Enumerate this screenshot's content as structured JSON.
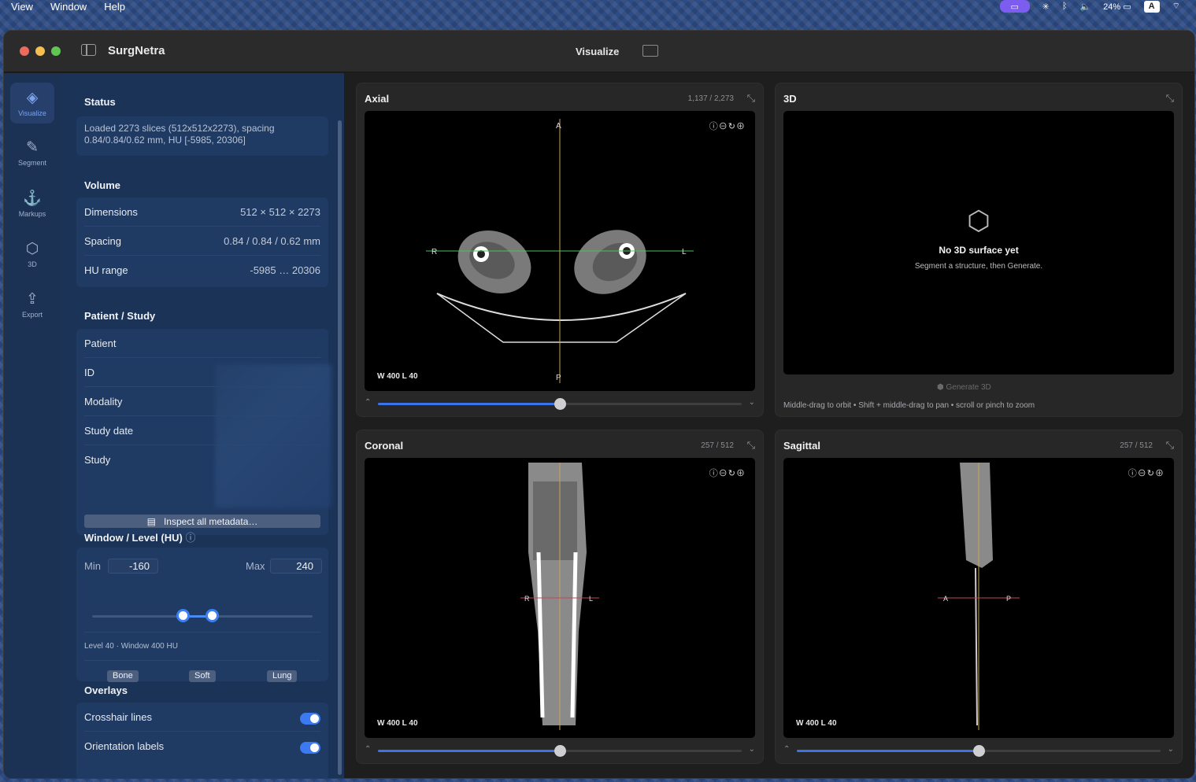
{
  "menubar": {
    "items": [
      "View",
      "Window",
      "Help"
    ],
    "battery": "24%",
    "keyboard": "A"
  },
  "window": {
    "app_title": "SurgNetra",
    "title": "Visualize"
  },
  "rail": [
    {
      "label": "Visualize",
      "icon": "layers-icon"
    },
    {
      "label": "Segment",
      "icon": "brush-icon"
    },
    {
      "label": "Markups",
      "icon": "pin-icon"
    },
    {
      "label": "3D",
      "icon": "cube-icon"
    },
    {
      "label": "Export",
      "icon": "share-icon"
    }
  ],
  "status": {
    "heading": "Status",
    "text": "Loaded 2273 slices (512x512x2273), spacing 0.84/0.84/0.62 mm, HU [-5985, 20306]"
  },
  "volume": {
    "heading": "Volume",
    "rows": [
      {
        "k": "Dimensions",
        "v": "512 × 512 × 2273"
      },
      {
        "k": "Spacing",
        "v": "0.84 / 0.84 / 0.62 mm"
      },
      {
        "k": "HU range",
        "v": "-5985 … 20306"
      }
    ]
  },
  "patient": {
    "heading": "Patient / Study",
    "rows": [
      "Patient",
      "ID",
      "Modality",
      "Study date",
      "Study"
    ],
    "inspect_label": "Inspect all metadata…"
  },
  "window_level": {
    "heading": "Window / Level (HU)",
    "min_label": "Min",
    "min_value": "-160",
    "max_label": "Max",
    "max_value": "240",
    "summary": "Level 40 · Window 400 HU",
    "presets": [
      "Bone",
      "Soft",
      "Lung"
    ],
    "hu_range": [
      -5985,
      20306
    ],
    "min_hu": -160,
    "max_hu": 240
  },
  "overlays": {
    "heading": "Overlays",
    "items": [
      {
        "label": "Crosshair lines",
        "on": true
      },
      {
        "label": "Orientation labels",
        "on": true
      }
    ]
  },
  "panels": {
    "axial": {
      "title": "Axial",
      "count": "1,137 / 2,273",
      "wl": "W 400  L 40",
      "labels": {
        "top": "A",
        "bottom": "P",
        "left": "R",
        "right": "L"
      },
      "slice_fraction": 0.5
    },
    "three_d": {
      "title": "3D",
      "empty_title": "No 3D surface yet",
      "empty_sub": "Segment a structure, then Generate.",
      "generate": "Generate 3D",
      "help": "Middle-drag to orbit • Shift + middle-drag to pan • scroll or pinch to zoom"
    },
    "coronal": {
      "title": "Coronal",
      "count": "257 / 512",
      "wl": "W 400  L 40",
      "labels": {
        "left": "R",
        "right": "L"
      },
      "slice_fraction": 0.5
    },
    "sagittal": {
      "title": "Sagittal",
      "count": "257 / 512",
      "wl": "W 400  L 40",
      "labels": {
        "left": "A",
        "right": "P"
      },
      "slice_fraction": 0.5
    }
  },
  "colors": {
    "accent": "#3b7af0",
    "crosshair_h_axial": "#4fbf5a",
    "crosshair_v": "#c9a25a",
    "crosshair_h": "#c2475c"
  }
}
